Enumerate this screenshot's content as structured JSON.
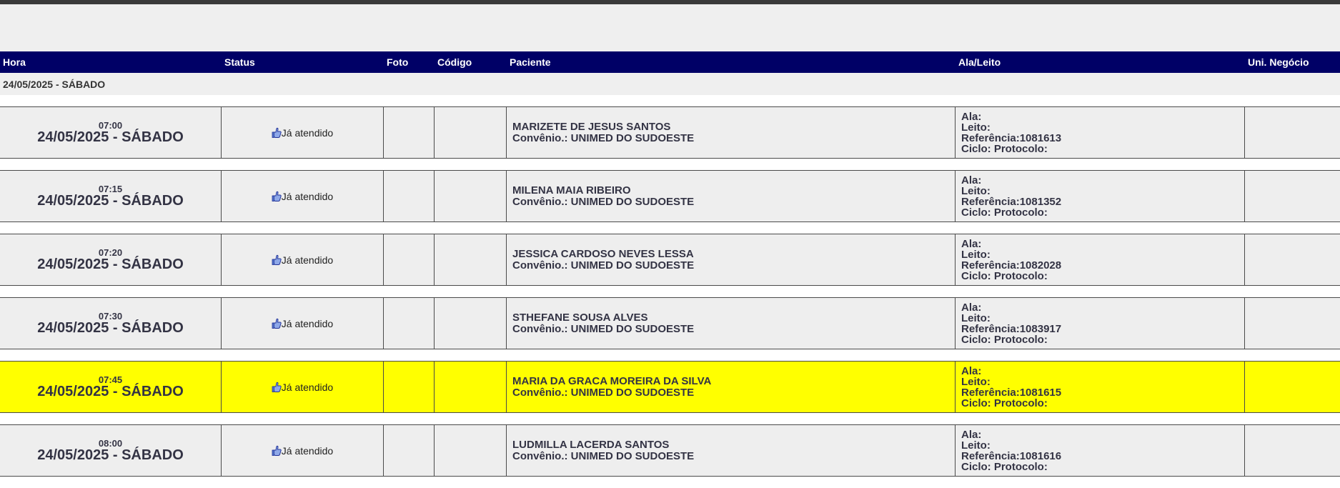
{
  "columns": [
    "Hora",
    "Status",
    "Foto",
    "Código",
    "Paciente",
    "Ala/Leito",
    "Uni. Negócio"
  ],
  "date_group": "24/05/2025 - SÁBADO",
  "labels": {
    "convenio_prefix": "Convênio.: ",
    "ala": "Ala:",
    "leito": "Leito:",
    "referencia_prefix": "Referência:",
    "ciclo": "Ciclo: Protocolo:"
  },
  "rows": [
    {
      "time": "07:00",
      "date": "24/05/2025 - SÁBADO",
      "status": "Já atendido",
      "patient": "MARIZETE DE JESUS SANTOS",
      "convenio": "Convênio.: UNIMED DO SUDOESTE",
      "referencia": "Referência:1081613",
      "highlight": false
    },
    {
      "time": "07:15",
      "date": "24/05/2025 - SÁBADO",
      "status": "Já atendido",
      "patient": "MILENA MAIA RIBEIRO",
      "convenio": "Convênio.: UNIMED DO SUDOESTE",
      "referencia": "Referência:1081352",
      "highlight": false
    },
    {
      "time": "07:20",
      "date": "24/05/2025 - SÁBADO",
      "status": "Já atendido",
      "patient": "JESSICA CARDOSO NEVES LESSA",
      "convenio": "Convênio.: UNIMED DO SUDOESTE",
      "referencia": "Referência:1082028",
      "highlight": false
    },
    {
      "time": "07:30",
      "date": "24/05/2025 - SÁBADO",
      "status": "Já atendido",
      "patient": "STHEFANE SOUSA ALVES",
      "convenio": "Convênio.: UNIMED DO SUDOESTE",
      "referencia": "Referência:1083917",
      "highlight": false
    },
    {
      "time": "07:45",
      "date": "24/05/2025 - SÁBADO",
      "status": "Já atendido",
      "patient": "MARIA DA GRACA MOREIRA DA SILVA",
      "convenio": "Convênio.: UNIMED DO SUDOESTE",
      "referencia": "Referência:1081615",
      "highlight": true
    },
    {
      "time": "08:00",
      "date": "24/05/2025 - SÁBADO",
      "status": "Já atendido",
      "patient": "LUDMILLA LACERDA SANTOS",
      "convenio": "Convênio.: UNIMED DO SUDOESTE",
      "referencia": "Referência:1081616",
      "highlight": false
    }
  ],
  "colors": {
    "header_bg": "#000066",
    "highlight": "#ffff00",
    "row_bg": "#eeeeee"
  }
}
